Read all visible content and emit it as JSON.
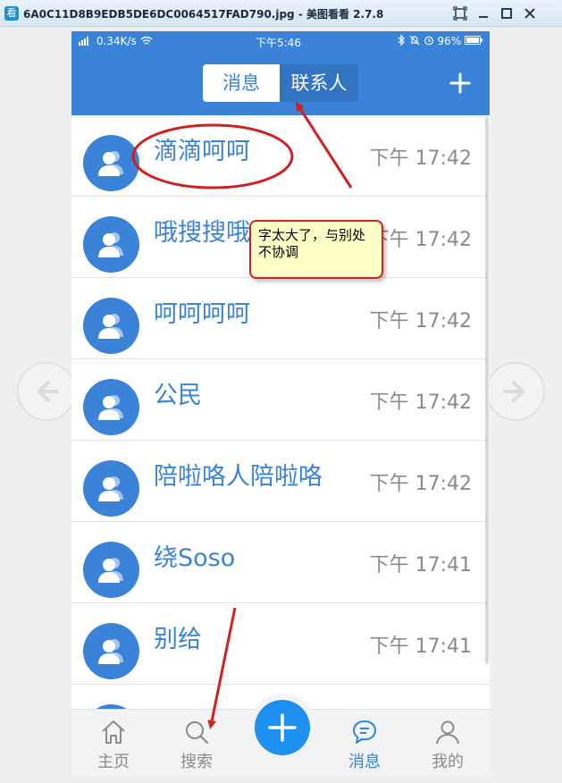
{
  "window": {
    "title": "6A0C11D8B9EDB5DE6DC0064517FAD790.jpg - 美图看看 2.7.8",
    "app_icon_glyph": "看",
    "buttons": [
      "fit-screen-icon",
      "minimize-icon",
      "maximize-icon",
      "close-icon"
    ]
  },
  "status_bar": {
    "left": "0.34K/s",
    "center": "下午5:46",
    "right": "96%"
  },
  "header": {
    "tabs": [
      {
        "label": "消息",
        "active": true
      },
      {
        "label": "联系人",
        "active": false
      }
    ],
    "plus_icon": "plus-icon"
  },
  "conversations": [
    {
      "name": "滴滴呵呵",
      "time": "下午 17:42"
    },
    {
      "name": "哦搜搜哦",
      "time": "下午 17:42"
    },
    {
      "name": "呵呵呵呵",
      "time": "下午 17:42"
    },
    {
      "name": "公民",
      "time": "下午 17:42"
    },
    {
      "name": "陪啦咯人陪啦咯",
      "time": "下午 17:42"
    },
    {
      "name": "绕Soso",
      "time": "下午 17:41"
    },
    {
      "name": "别给",
      "time": "下午 17:41"
    },
    {
      "name": "",
      "time": ""
    }
  ],
  "tab_bar": {
    "items": [
      {
        "label": "主页",
        "icon": "home-icon",
        "active": false
      },
      {
        "label": "搜索",
        "icon": "search-icon",
        "active": false
      },
      {
        "label": "消息",
        "icon": "message-icon",
        "active": true
      },
      {
        "label": "我的",
        "icon": "profile-icon",
        "active": false
      }
    ],
    "center_button_icon": "plus-icon"
  },
  "annotation": {
    "callout_text": "字太大了，与别处不协调"
  },
  "colors": {
    "primary": "#3a83d8",
    "fab": "#1e90f0",
    "annotation_red": "#d02020",
    "callout_bg": "#ffffc8"
  }
}
